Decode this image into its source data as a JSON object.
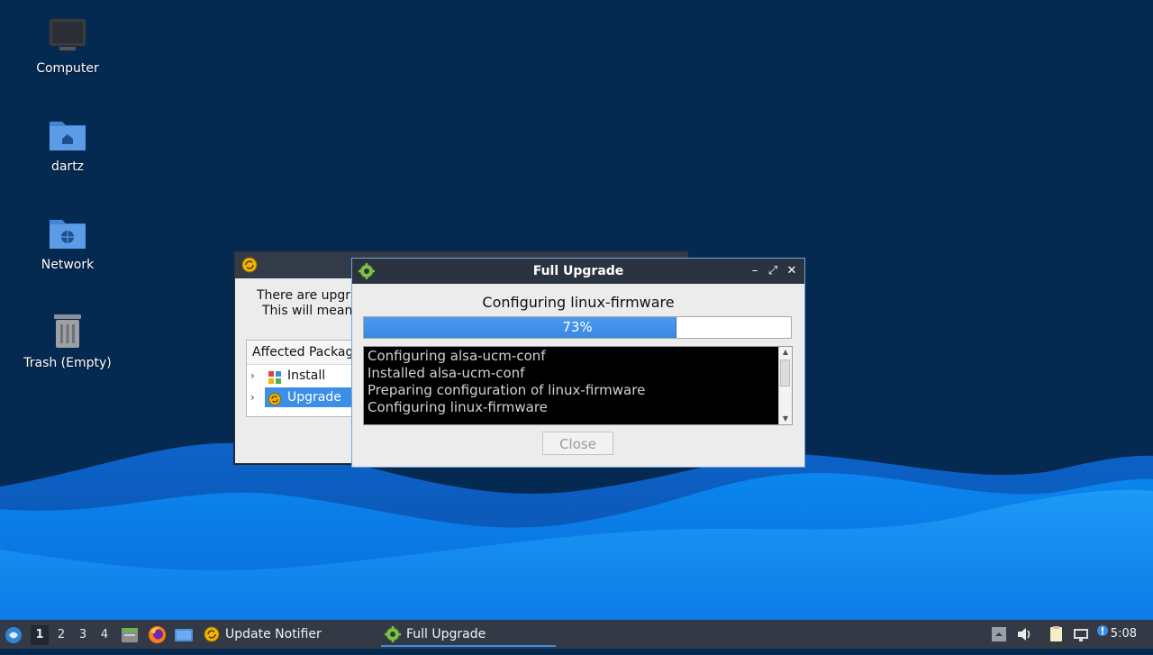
{
  "desktop": {
    "icons": [
      {
        "label": "Computer",
        "icon": "computer-icon"
      },
      {
        "label": "dartz",
        "icon": "home-folder-icon"
      },
      {
        "label": "Network",
        "icon": "network-folder-icon"
      },
      {
        "label": "Trash (Empty)",
        "icon": "trash-icon"
      }
    ]
  },
  "notifier_window": {
    "body_line1": "There are upgra",
    "body_line2": "This will mean",
    "affected_header": "Affected Packag",
    "tree": [
      {
        "label": "Install",
        "icon": "install-icon"
      },
      {
        "label": "Upgrade",
        "icon": "upgrade-icon",
        "selected": true
      }
    ]
  },
  "upgrade_window": {
    "title": "Full Upgrade",
    "status": "Configuring linux-firmware",
    "progress_label": "73%",
    "progress_value": 0.73,
    "log": [
      "Configuring alsa-ucm-conf",
      "Installed alsa-ucm-conf",
      "Preparing configuration of linux-firmware",
      "Configuring linux-firmware"
    ],
    "close_label": "Close",
    "controls": {
      "minimize": "–",
      "maximize": "⤢",
      "close": "✕"
    }
  },
  "taskbar": {
    "workspaces": [
      "1",
      "2",
      "3",
      "4"
    ],
    "active_workspace": "1",
    "tasks": [
      {
        "label": "Update Notifier",
        "icon": "update-notifier-icon"
      },
      {
        "label": "Full Upgrade",
        "icon": "gear-icon",
        "active": true
      }
    ],
    "clock": "5:08"
  },
  "colors": {
    "desktop_bg": "#052a52",
    "accent": "#3d8ee6",
    "titlebar": "#2b3340",
    "taskbar": "#333a45"
  }
}
